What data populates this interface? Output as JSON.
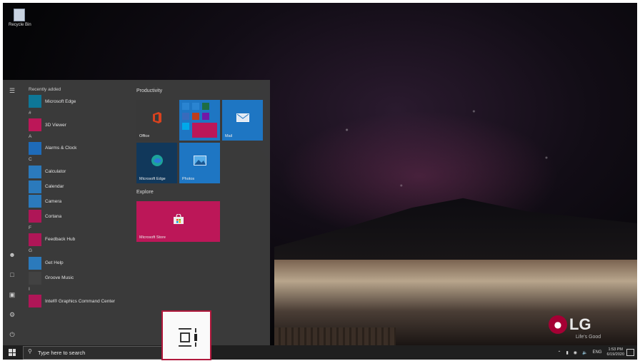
{
  "desktop": {
    "recycle_bin_label": "Recycle Bin",
    "brand": {
      "logo_text": "LG",
      "tagline": "Life's Good",
      "color": "#a50034"
    }
  },
  "start_menu": {
    "app_list": [
      {
        "type": "section",
        "label": "Recently added"
      },
      {
        "type": "app",
        "label": "Microsoft Edge",
        "color": "#0f7b9c",
        "icon": "edge-icon"
      },
      {
        "type": "section",
        "label": "#"
      },
      {
        "type": "app",
        "label": "3D Viewer",
        "color": "#c2185b",
        "icon": "3d-viewer-icon"
      },
      {
        "type": "section",
        "label": "A"
      },
      {
        "type": "app",
        "label": "Alarms & Clock",
        "color": "#1f6fbf",
        "icon": "clock-icon"
      },
      {
        "type": "section",
        "label": "C"
      },
      {
        "type": "app",
        "label": "Calculator",
        "color": "#2d7ec2",
        "icon": "calculator-icon"
      },
      {
        "type": "app",
        "label": "Calendar",
        "color": "#2d7ec2",
        "icon": "calendar-icon"
      },
      {
        "type": "app",
        "label": "Camera",
        "color": "#2d7ec2",
        "icon": "camera-icon"
      },
      {
        "type": "app",
        "label": "Cortana",
        "color": "#b5175a",
        "icon": "cortana-icon"
      },
      {
        "type": "section",
        "label": "F"
      },
      {
        "type": "app",
        "label": "Feedback Hub",
        "color": "#b5175a",
        "icon": "feedback-icon"
      },
      {
        "type": "section",
        "label": "G"
      },
      {
        "type": "app",
        "label": "Get Help",
        "color": "#2d7ec2",
        "icon": "help-icon"
      },
      {
        "type": "app",
        "label": "Groove Music",
        "color": "#444444",
        "icon": "music-icon"
      },
      {
        "type": "section",
        "label": "I"
      },
      {
        "type": "app",
        "label": "Intel® Graphics Command Center",
        "color": "#b5175a",
        "icon": "intel-icon"
      }
    ],
    "groups": {
      "productivity": "Productivity",
      "explore": "Explore"
    },
    "tiles": {
      "office": "Office",
      "mail": "Mail",
      "edge": "Microsoft Edge",
      "photos": "Photos",
      "store": "Microsoft Store"
    }
  },
  "taskbar": {
    "search_placeholder": "Type here to search",
    "language": "ENG",
    "time": "1:53 PM",
    "date": "6/19/2020"
  },
  "colors": {
    "tile_blue": "#1f7ac9",
    "tile_dark": "#3b3b3b",
    "tile_magenta": "#c2185b",
    "highlight_border": "#b0173b"
  }
}
